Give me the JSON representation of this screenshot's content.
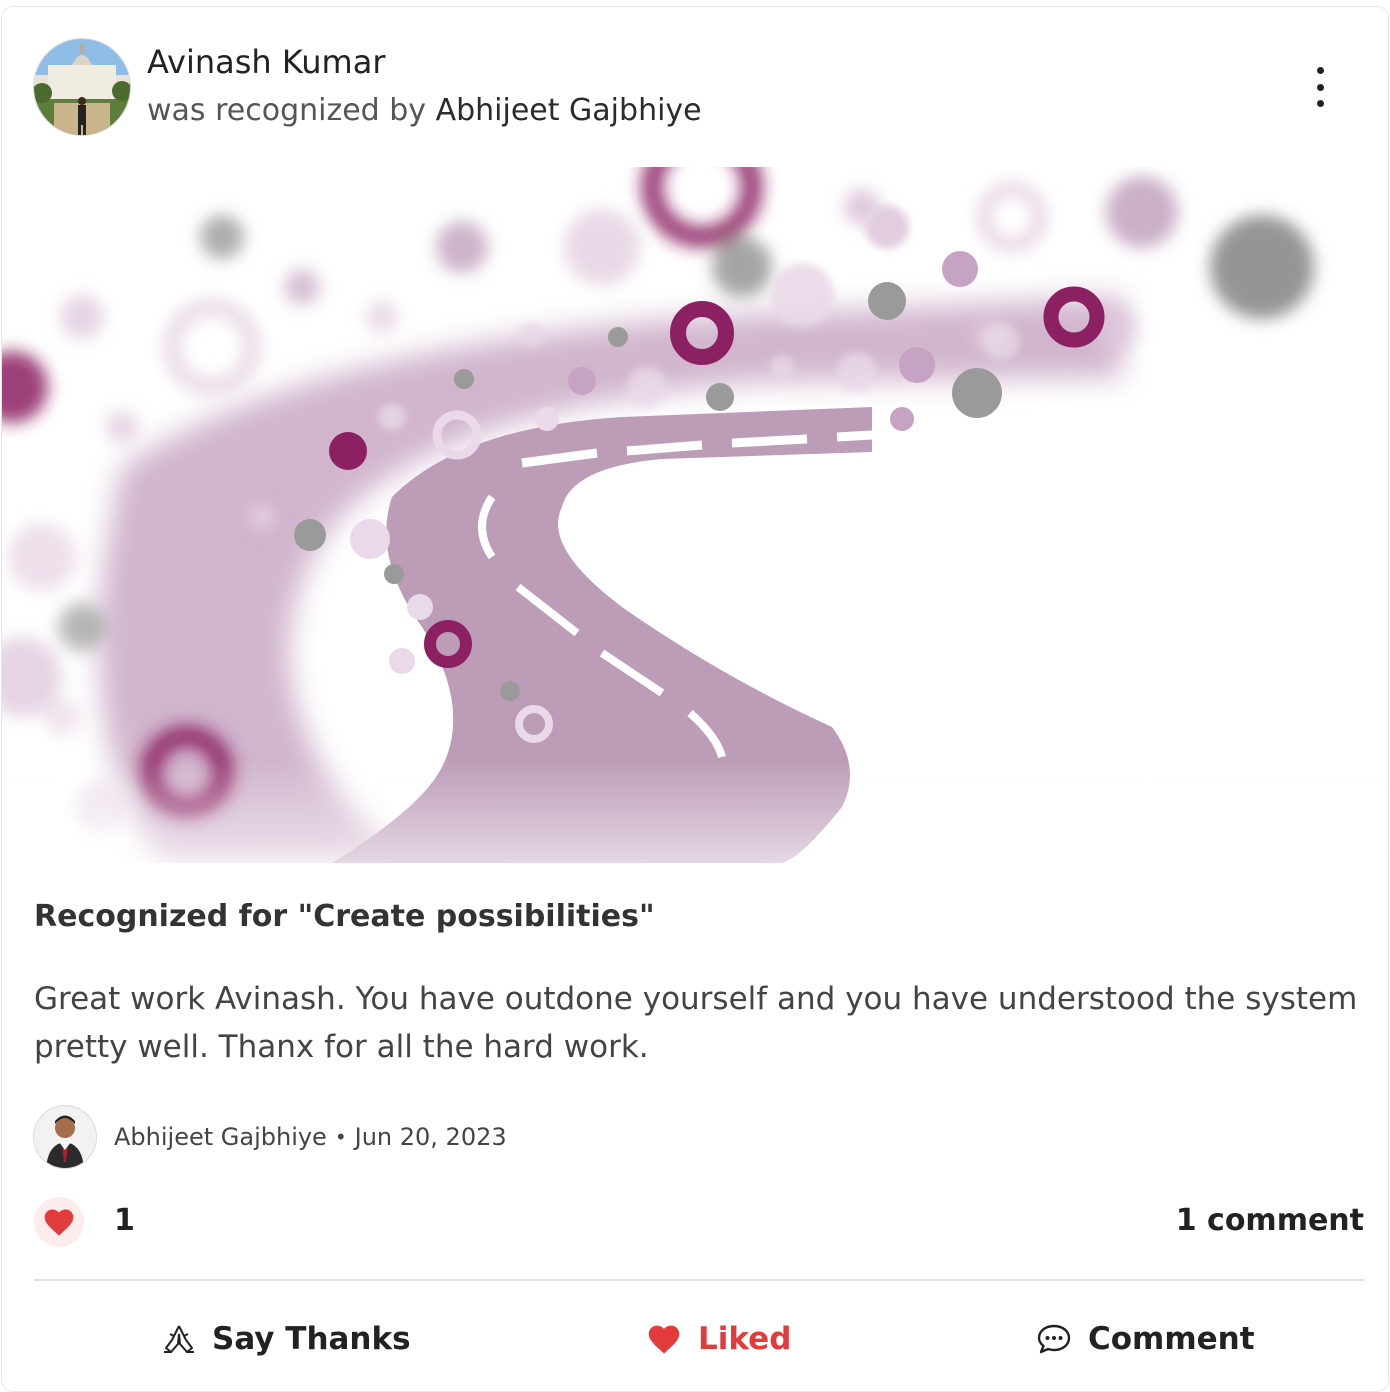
{
  "post": {
    "recipient_name": "Avinash Kumar",
    "recognized_by_prefix": "was recognized by",
    "recognizer_name": "Abhijeet Gajbhiye",
    "reason": "Recognized for \"Create possibilities\"",
    "message": "Great work Avinash. You have outdone yourself and you have understood the system pretty well. Thanx for all the hard work.",
    "author_name": "Abhijeet Gajbhiye",
    "separator": "•",
    "date": "Jun 20, 2023"
  },
  "stats": {
    "like_count": "1",
    "comment_count_label": "1 comment"
  },
  "actions": {
    "say_thanks": "Say Thanks",
    "liked": "Liked",
    "comment": "Comment"
  },
  "icons": {
    "more": "more-vertical-icon",
    "heart": "heart-icon",
    "thanks": "praying-hands-icon",
    "comment": "chat-bubble-icon"
  },
  "colors": {
    "accent_red": "#e23b3b",
    "road": "#bd9cb8",
    "magenta": "#8b2162",
    "grey": "#9a9a9a"
  }
}
